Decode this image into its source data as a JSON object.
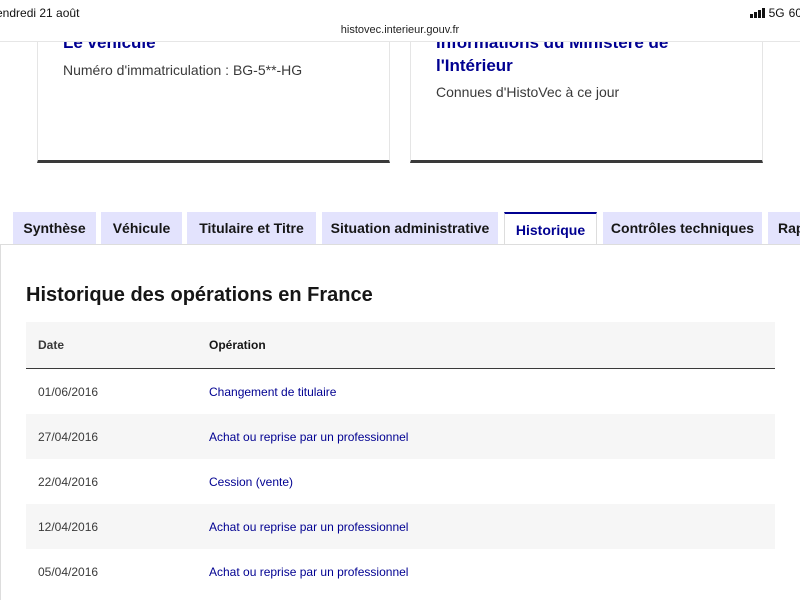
{
  "status_bar": {
    "time_date": "endredi 21 août",
    "url": "histovec.interieur.gouv.fr",
    "network": "5G",
    "battery": "60"
  },
  "cards": {
    "vehicle": {
      "title": "Le véhicule",
      "text": "Numéro d'immatriculation : BG-5**-HG"
    },
    "ministry": {
      "title": "Informations du Ministère de l'Intérieur",
      "text": "Connues d'HistoVec à ce jour"
    }
  },
  "tabs": [
    {
      "label": "Synthèse",
      "active": false
    },
    {
      "label": "Véhicule",
      "active": false
    },
    {
      "label": "Titulaire et Titre",
      "active": false
    },
    {
      "label": "Situation administrative",
      "active": false
    },
    {
      "label": "Historique",
      "active": true
    },
    {
      "label": "Contrôles techniques",
      "active": false
    },
    {
      "label": "Rap",
      "active": false
    }
  ],
  "history": {
    "title": "Historique des opérations en France",
    "columns": {
      "date": "Date",
      "operation": "Opération"
    },
    "rows": [
      {
        "date": "01/06/2016",
        "operation": "Changement de titulaire"
      },
      {
        "date": "27/04/2016",
        "operation": "Achat ou reprise par un professionnel"
      },
      {
        "date": "22/04/2016",
        "operation": "Cession (vente)"
      },
      {
        "date": "12/04/2016",
        "operation": "Achat ou reprise par un professionnel"
      },
      {
        "date": "05/04/2016",
        "operation": "Achat ou reprise par un professionnel"
      }
    ]
  },
  "colors": {
    "brand_blue": "#000091",
    "tab_background": "#e3e3fd",
    "row_alt": "#f6f6f6"
  }
}
